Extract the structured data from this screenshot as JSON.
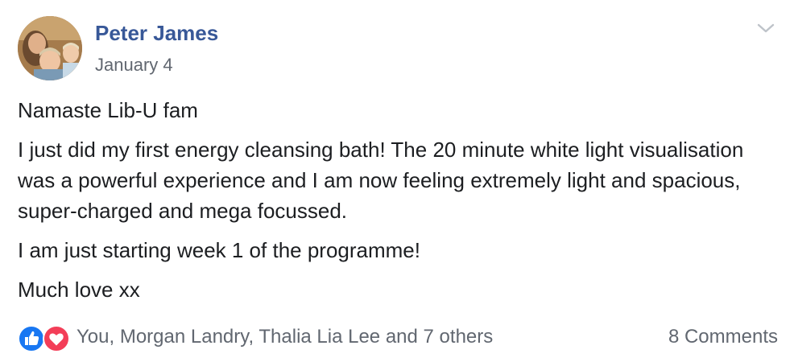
{
  "post": {
    "author": "Peter James",
    "date": "January 4",
    "paragraphs": [
      "Namaste Lib-U fam",
      "I just did my first energy cleansing bath! The 20 minute white light visualisation was a powerful experience and I am now feeling extremely light and spacious, super-charged and mega focussed.",
      "I am just starting week 1 of the programme!",
      "Much love xx"
    ],
    "reactions_text": "You, Morgan Landry, Thalia Lia Lee and 7 others",
    "comments_text": "8 Comments",
    "icons": {
      "options": "chevron-down-icon",
      "like": "like-reaction-icon",
      "love": "love-reaction-icon"
    },
    "colors": {
      "author": "#385898",
      "meta": "#616770",
      "text": "#1c1e21",
      "like": "#1877f2",
      "love": "#f33e58"
    }
  }
}
